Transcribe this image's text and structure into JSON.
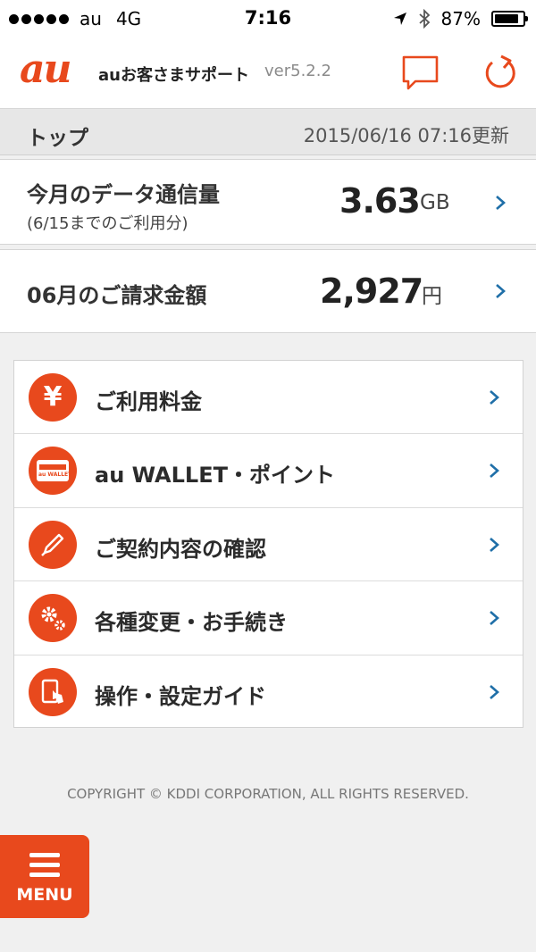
{
  "status_bar": {
    "carrier": "au",
    "network": "4G",
    "time": "7:16",
    "battery": "87%",
    "battery_level": 0.87
  },
  "header": {
    "logo": "au",
    "app_name": "auお客さまサポート",
    "version": "ver5.2.2",
    "chat_icon": "chat-bubble-icon",
    "refresh_icon": "refresh-icon"
  },
  "top_bar": {
    "title": "トップ",
    "updated": "2015/06/16 07:16更新"
  },
  "data_usage": {
    "label": "今月のデータ通信量",
    "sub_label": "(6/15までのご利用分)",
    "value": "3.63",
    "unit": "GB"
  },
  "billing": {
    "label": "06月のご請求金額",
    "value": "2,927",
    "unit": "円"
  },
  "menu_items": [
    {
      "label": "ご利用料金",
      "icon": "yen-icon"
    },
    {
      "label": "au WALLET・ポイント",
      "icon": "wallet-card-icon",
      "icon_text": "au WALLET"
    },
    {
      "label": "ご契約内容の確認",
      "icon": "pen-icon"
    },
    {
      "label": "各種変更・お手続き",
      "icon": "gears-icon"
    },
    {
      "label": "操作・設定ガイド",
      "icon": "phone-tap-icon"
    }
  ],
  "copyright": "COPYRIGHT © KDDI CORPORATION, ALL RIGHTS RESERVED.",
  "menu_button": {
    "label": "MENU",
    "icon": "hamburger-icon"
  },
  "colors": {
    "accent": "#e8491d",
    "chevron": "#1f6fa8"
  }
}
